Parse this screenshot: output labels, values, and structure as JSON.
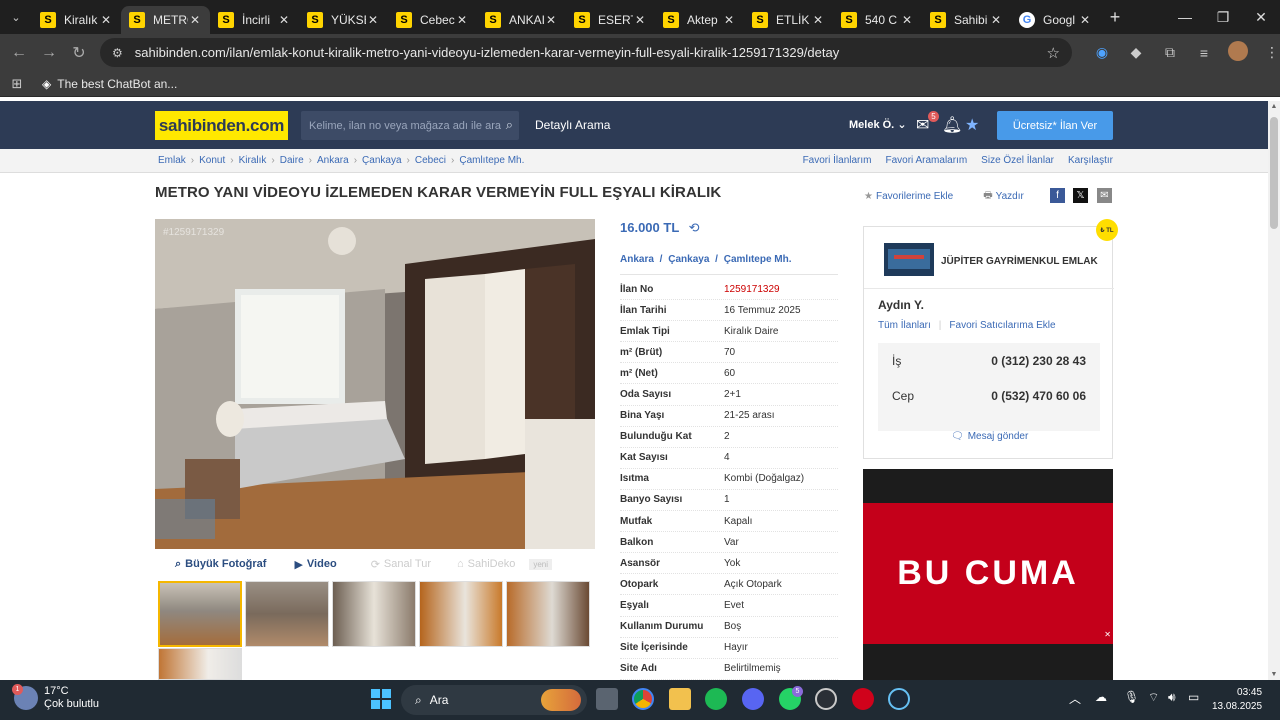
{
  "browser": {
    "tabs": [
      {
        "label": "Kiralık",
        "icon": "S",
        "active": false
      },
      {
        "label": "METRO",
        "icon": "S",
        "active": true
      },
      {
        "label": "İncirli",
        "icon": "S",
        "active": false
      },
      {
        "label": "YÜKSE",
        "icon": "S",
        "active": false
      },
      {
        "label": "Cebeci",
        "icon": "S",
        "active": false
      },
      {
        "label": "ANKAI",
        "icon": "S",
        "active": false
      },
      {
        "label": "ESERT",
        "icon": "S",
        "active": false
      },
      {
        "label": "Aktep",
        "icon": "S",
        "active": false
      },
      {
        "label": "ETLİK",
        "icon": "S",
        "active": false
      },
      {
        "label": "540 C",
        "icon": "S",
        "active": false
      },
      {
        "label": "Sahibi",
        "icon": "S",
        "active": false
      },
      {
        "label": "Googl",
        "icon": "G",
        "active": false
      }
    ],
    "url": "sahibinden.com/ilan/emlak-konut-kiralik-metro-yani-videoyu-izlemeden-karar-vermeyin-full-esyali-kiralik-1259171329/detay",
    "bookmark": "The best ChatBot an..."
  },
  "site": {
    "logo": "sahibinden.com",
    "search_placeholder": "Kelime, ilan no veya mağaza adı ile ara",
    "advanced_search": "Detaylı Arama",
    "user_name": "Melek Ö.",
    "message_count": "5",
    "cta": "Ücretsiz* İlan Ver"
  },
  "breadcrumbs": [
    "Emlak",
    "Konut",
    "Kiralık",
    "Daire",
    "Ankara",
    "Çankaya",
    "Cebeci",
    "Çamlıtepe Mh."
  ],
  "top_links": [
    "Favori İlanlarım",
    "Favori Aramalarım",
    "Size Özel İlanlar",
    "Karşılaştır"
  ],
  "listing": {
    "title": "METRO YANI VİDEOYU İZLEMEDEN KARAR VERMEYİN FULL EŞYALI KİRALIK",
    "add_favorite": "Favorilerime Ekle",
    "print": "Yazdır",
    "photo_id": "#1259171329",
    "photo_tools": {
      "big_photo": "Büyük Fotoğraf",
      "video": "Video",
      "virtual_tour": "Sanal Tur",
      "sahideko": "SahiDeko",
      "new_tag": "yeni"
    },
    "price": "16.000 TL",
    "location": [
      "Ankara",
      "Çankaya",
      "Çamlıtepe Mh."
    ],
    "details": [
      {
        "key": "İlan No",
        "value": "1259171329",
        "highlight": true
      },
      {
        "key": "İlan Tarihi",
        "value": "16 Temmuz 2025"
      },
      {
        "key": "Emlak Tipi",
        "value": "Kiralık Daire"
      },
      {
        "key": "m² (Brüt)",
        "value": "70"
      },
      {
        "key": "m² (Net)",
        "value": "60"
      },
      {
        "key": "Oda Sayısı",
        "value": "2+1"
      },
      {
        "key": "Bina Yaşı",
        "value": "21-25 arası"
      },
      {
        "key": "Bulunduğu Kat",
        "value": "2"
      },
      {
        "key": "Kat Sayısı",
        "value": "4"
      },
      {
        "key": "Isıtma",
        "value": "Kombi (Doğalgaz)"
      },
      {
        "key": "Banyo Sayısı",
        "value": "1"
      },
      {
        "key": "Mutfak",
        "value": "Kapalı"
      },
      {
        "key": "Balkon",
        "value": "Var"
      },
      {
        "key": "Asansör",
        "value": "Yok"
      },
      {
        "key": "Otopark",
        "value": "Açık Otopark"
      },
      {
        "key": "Eşyalı",
        "value": "Evet"
      },
      {
        "key": "Kullanım Durumu",
        "value": "Boş"
      },
      {
        "key": "Site İçerisinde",
        "value": "Hayır"
      },
      {
        "key": "Site Adı",
        "value": "Belirtilmemiş"
      }
    ]
  },
  "seller": {
    "office": "JÜPİTER GAYRİMENKUL EMLAK",
    "agent": "Aydın Y.",
    "all_listings": "Tüm İlanları",
    "add_favorite_seller": "Favori Satıcılarıma Ekle",
    "phones": [
      {
        "label": "İş",
        "number": "0 (312) 230 28 43"
      },
      {
        "label": "Cep",
        "number": "0 (532) 470 60 06"
      }
    ],
    "send_message": "Mesaj gönder",
    "tl_badge": "₺ TL"
  },
  "ad": {
    "text": "BU CUMA"
  },
  "taskbar": {
    "temperature": "17°C",
    "weather": "Çok bulutlu",
    "weather_badge": "1",
    "search": "Ara",
    "whatsapp_badge": "5",
    "time": "03:45",
    "date": "13.08.2025"
  }
}
